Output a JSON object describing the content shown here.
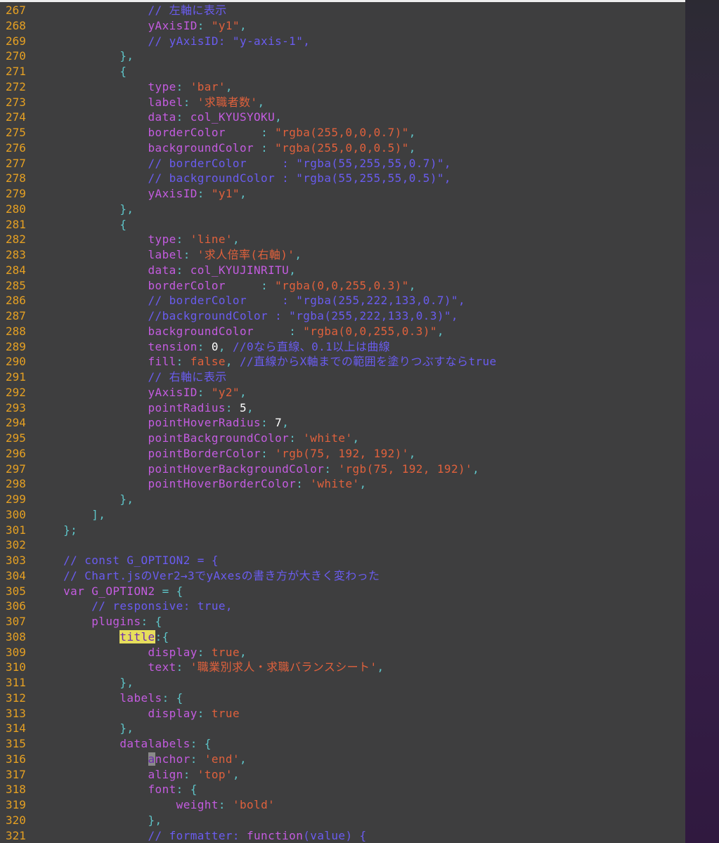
{
  "colors": {
    "background": "#3e3e3f",
    "line_number": "#e5a023",
    "punctuation": "#5ec4c8",
    "key": "#c45ce0",
    "string": "#e0613c",
    "comment": "#6a5cf0",
    "number": "#ffffff",
    "search_highlight": "#e6de5c"
  },
  "lines": [
    {
      "n": "267",
      "t": [
        [
          "c",
          "                // 左軸に表示"
        ]
      ]
    },
    {
      "n": "268",
      "t": [
        [
          "k",
          "                yAxisID"
        ],
        [
          "p",
          ": "
        ],
        [
          "s",
          "\"y1\""
        ],
        [
          "p",
          ","
        ]
      ]
    },
    {
      "n": "269",
      "t": [
        [
          "c",
          "                // yAxisID: \"y-axis-1\","
        ]
      ]
    },
    {
      "n": "270",
      "t": [
        [
          "p",
          "            },"
        ]
      ]
    },
    {
      "n": "271",
      "t": [
        [
          "p",
          "            {"
        ]
      ]
    },
    {
      "n": "272",
      "t": [
        [
          "k",
          "                type"
        ],
        [
          "p",
          ": "
        ],
        [
          "s",
          "'bar'"
        ],
        [
          "p",
          ","
        ]
      ]
    },
    {
      "n": "273",
      "t": [
        [
          "k",
          "                label"
        ],
        [
          "p",
          ": "
        ],
        [
          "s",
          "'求職者数'"
        ],
        [
          "p",
          ","
        ]
      ]
    },
    {
      "n": "274",
      "t": [
        [
          "k",
          "                data"
        ],
        [
          "p",
          ": "
        ],
        [
          "k",
          "col_KYUSYOKU"
        ],
        [
          "p",
          ","
        ]
      ]
    },
    {
      "n": "275",
      "t": [
        [
          "k",
          "                borderColor     "
        ],
        [
          "p",
          ": "
        ],
        [
          "s",
          "\"rgba(255,0,0,0.7)\""
        ],
        [
          "p",
          ","
        ]
      ]
    },
    {
      "n": "276",
      "t": [
        [
          "k",
          "                backgroundColor "
        ],
        [
          "p",
          ": "
        ],
        [
          "s",
          "\"rgba(255,0,0,0.5)\""
        ],
        [
          "p",
          ","
        ]
      ]
    },
    {
      "n": "277",
      "t": [
        [
          "c",
          "                // borderColor     : \"rgba(55,255,55,0.7)\","
        ]
      ]
    },
    {
      "n": "278",
      "t": [
        [
          "c",
          "                // backgroundColor : \"rgba(55,255,55,0.5)\","
        ]
      ]
    },
    {
      "n": "279",
      "t": [
        [
          "k",
          "                yAxisID"
        ],
        [
          "p",
          ": "
        ],
        [
          "s",
          "\"y1\""
        ],
        [
          "p",
          ","
        ]
      ]
    },
    {
      "n": "280",
      "t": [
        [
          "p",
          "            },"
        ]
      ]
    },
    {
      "n": "281",
      "t": [
        [
          "p",
          "            {"
        ]
      ]
    },
    {
      "n": "282",
      "t": [
        [
          "k",
          "                type"
        ],
        [
          "p",
          ": "
        ],
        [
          "s",
          "'line'"
        ],
        [
          "p",
          ","
        ]
      ]
    },
    {
      "n": "283",
      "t": [
        [
          "k",
          "                label"
        ],
        [
          "p",
          ": "
        ],
        [
          "s",
          "'求人倍率(右軸)'"
        ],
        [
          "p",
          ","
        ]
      ]
    },
    {
      "n": "284",
      "t": [
        [
          "k",
          "                data"
        ],
        [
          "p",
          ": "
        ],
        [
          "k",
          "col_KYUJINRITU"
        ],
        [
          "p",
          ","
        ]
      ]
    },
    {
      "n": "285",
      "t": [
        [
          "k",
          "                borderColor     "
        ],
        [
          "p",
          ": "
        ],
        [
          "s",
          "\"rgba(0,0,255,0.3)\""
        ],
        [
          "p",
          ","
        ]
      ]
    },
    {
      "n": "286",
      "t": [
        [
          "c",
          "                // borderColor     : \"rgba(255,222,133,0.7)\","
        ]
      ]
    },
    {
      "n": "287",
      "t": [
        [
          "c",
          "                //backgroundColor : \"rgba(255,222,133,0.3)\","
        ]
      ]
    },
    {
      "n": "288",
      "t": [
        [
          "k",
          "                backgroundColor     "
        ],
        [
          "p",
          ": "
        ],
        [
          "s",
          "\"rgba(0,0,255,0.3)\""
        ],
        [
          "p",
          ","
        ]
      ]
    },
    {
      "n": "289",
      "t": [
        [
          "k",
          "                tension"
        ],
        [
          "p",
          ": "
        ],
        [
          "n",
          "0"
        ],
        [
          "p",
          ", "
        ],
        [
          "c",
          "//0なら直線、0.1以上は曲線"
        ]
      ]
    },
    {
      "n": "290",
      "t": [
        [
          "k",
          "                fill"
        ],
        [
          "p",
          ": "
        ],
        [
          "s",
          "false"
        ],
        [
          "p",
          ", "
        ],
        [
          "c",
          "//直線からX軸までの範囲を塗りつぶすならtrue"
        ]
      ]
    },
    {
      "n": "291",
      "t": [
        [
          "c",
          "                // 右軸に表示"
        ]
      ]
    },
    {
      "n": "292",
      "t": [
        [
          "k",
          "                yAxisID"
        ],
        [
          "p",
          ": "
        ],
        [
          "s",
          "\"y2\""
        ],
        [
          "p",
          ","
        ]
      ]
    },
    {
      "n": "293",
      "t": [
        [
          "k",
          "                pointRadius"
        ],
        [
          "p",
          ": "
        ],
        [
          "n",
          "5"
        ],
        [
          "p",
          ","
        ]
      ]
    },
    {
      "n": "294",
      "t": [
        [
          "k",
          "                pointHoverRadius"
        ],
        [
          "p",
          ": "
        ],
        [
          "n",
          "7"
        ],
        [
          "p",
          ","
        ]
      ]
    },
    {
      "n": "295",
      "t": [
        [
          "k",
          "                pointBackgroundColor"
        ],
        [
          "p",
          ": "
        ],
        [
          "s",
          "'white'"
        ],
        [
          "p",
          ","
        ]
      ]
    },
    {
      "n": "296",
      "t": [
        [
          "k",
          "                pointBorderColor"
        ],
        [
          "p",
          ": "
        ],
        [
          "s",
          "'rgb(75, 192, 192)'"
        ],
        [
          "p",
          ","
        ]
      ]
    },
    {
      "n": "297",
      "t": [
        [
          "k",
          "                pointHoverBackgroundColor"
        ],
        [
          "p",
          ": "
        ],
        [
          "s",
          "'rgb(75, 192, 192)'"
        ],
        [
          "p",
          ","
        ]
      ]
    },
    {
      "n": "298",
      "t": [
        [
          "k",
          "                pointHoverBorderColor"
        ],
        [
          "p",
          ": "
        ],
        [
          "s",
          "'white'"
        ],
        [
          "p",
          ","
        ]
      ]
    },
    {
      "n": "299",
      "t": [
        [
          "p",
          "            },"
        ]
      ]
    },
    {
      "n": "300",
      "t": [
        [
          "p",
          "        ],"
        ]
      ]
    },
    {
      "n": "301",
      "t": [
        [
          "p",
          "    };"
        ]
      ]
    },
    {
      "n": "302",
      "t": []
    },
    {
      "n": "303",
      "t": [
        [
          "c",
          "    // const G_OPTION2 = {"
        ]
      ]
    },
    {
      "n": "304",
      "t": [
        [
          "c",
          "    // Chart.jsのVer2→3でyAxesの書き方が大きく変わった"
        ]
      ]
    },
    {
      "n": "305",
      "t": [
        [
          "k",
          "    var "
        ],
        [
          "k",
          "G_OPTION2"
        ],
        [
          "p",
          " = {"
        ]
      ]
    },
    {
      "n": "306",
      "t": [
        [
          "c",
          "        // responsive: true,"
        ]
      ]
    },
    {
      "n": "307",
      "t": [
        [
          "k",
          "        plugins"
        ],
        [
          "p",
          ": {"
        ]
      ]
    },
    {
      "n": "308",
      "t": [
        [
          "p",
          "            "
        ],
        [
          "hl",
          "title"
        ],
        [
          "p",
          ":{"
        ]
      ]
    },
    {
      "n": "309",
      "t": [
        [
          "k",
          "                display"
        ],
        [
          "p",
          ": "
        ],
        [
          "s",
          "true"
        ],
        [
          "p",
          ","
        ]
      ]
    },
    {
      "n": "310",
      "t": [
        [
          "k",
          "                text"
        ],
        [
          "p",
          ": "
        ],
        [
          "s",
          "'職業別求人・求職バランスシート'"
        ],
        [
          "p",
          ","
        ]
      ]
    },
    {
      "n": "311",
      "t": [
        [
          "p",
          "            },"
        ]
      ]
    },
    {
      "n": "312",
      "t": [
        [
          "k",
          "            labels"
        ],
        [
          "p",
          ": {"
        ]
      ]
    },
    {
      "n": "313",
      "t": [
        [
          "k",
          "                display"
        ],
        [
          "p",
          ": "
        ],
        [
          "s",
          "true"
        ]
      ]
    },
    {
      "n": "314",
      "t": [
        [
          "p",
          "            },"
        ]
      ]
    },
    {
      "n": "315",
      "t": [
        [
          "k",
          "            datalabels"
        ],
        [
          "p",
          ": {"
        ]
      ]
    },
    {
      "n": "316",
      "t": [
        [
          "p",
          "                "
        ],
        [
          "cur",
          "a"
        ],
        [
          "k",
          "nchor"
        ],
        [
          "p",
          ": "
        ],
        [
          "s",
          "'end'"
        ],
        [
          "p",
          ","
        ]
      ]
    },
    {
      "n": "317",
      "t": [
        [
          "k",
          "                align"
        ],
        [
          "p",
          ": "
        ],
        [
          "s",
          "'top'"
        ],
        [
          "p",
          ","
        ]
      ]
    },
    {
      "n": "318",
      "t": [
        [
          "k",
          "                font"
        ],
        [
          "p",
          ": {"
        ]
      ]
    },
    {
      "n": "319",
      "t": [
        [
          "k",
          "                    weight"
        ],
        [
          "p",
          ": "
        ],
        [
          "s",
          "'bold'"
        ]
      ]
    },
    {
      "n": "320",
      "t": [
        [
          "p",
          "                },"
        ]
      ]
    },
    {
      "n": "321",
      "t": [
        [
          "c",
          "                // formatter: "
        ],
        [
          "k",
          "function"
        ],
        [
          "c",
          "(value) {"
        ]
      ]
    }
  ]
}
